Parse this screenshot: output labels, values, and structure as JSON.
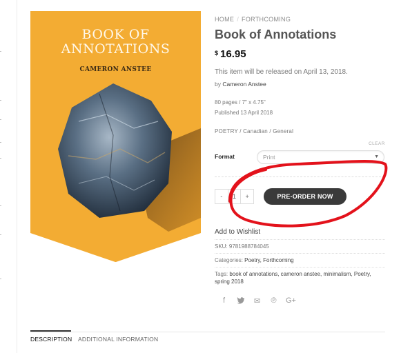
{
  "cover": {
    "title_line1": "BOOK OF",
    "title_line2": "ANNOTATIONS",
    "author": "CAMERON ANSTEE"
  },
  "breadcrumb": {
    "home": "HOME",
    "separator": "/",
    "current": "FORTHCOMING"
  },
  "product": {
    "title": "Book of Annotations",
    "currency": "$",
    "price": "16.95",
    "release_note": "This item will be released on April 13, 2018.",
    "by_prefix": "by",
    "author": "Cameron Anstee",
    "pages": "80 pages / 7\" x 4.75\"",
    "published": "Published 13 April 2018",
    "category_path": "POETRY / Canadian / General"
  },
  "variation": {
    "clear_label": "CLEAR",
    "format_label": "Format",
    "format_value": "Print"
  },
  "cart": {
    "minus": "-",
    "quantity": "1",
    "plus": "+",
    "preorder_label": "PRE-ORDER NOW"
  },
  "meta": {
    "add_to_wishlist": "Add to Wishlist",
    "sku_label": "SKU:",
    "sku_value": "9781988784045",
    "categories_label": "Categories:",
    "categories_value": "Poetry, Forthcoming",
    "tags_label": "Tags:",
    "tags_line1": "book of annotations, cameron anstee, minimalism, Poetry,",
    "tags_line2": "spring 2018"
  },
  "share_icons": [
    "facebook-icon",
    "twitter-icon",
    "email-icon",
    "pinterest-icon",
    "google-plus-icon"
  ],
  "tabs": [
    {
      "label": "DESCRIPTION",
      "active": true
    },
    {
      "label": "ADDITIONAL INFORMATION",
      "active": false
    }
  ],
  "colors": {
    "cover_background": "#f3ac33",
    "button_background": "#3a3a3a",
    "annotation_red": "#e3121b"
  }
}
